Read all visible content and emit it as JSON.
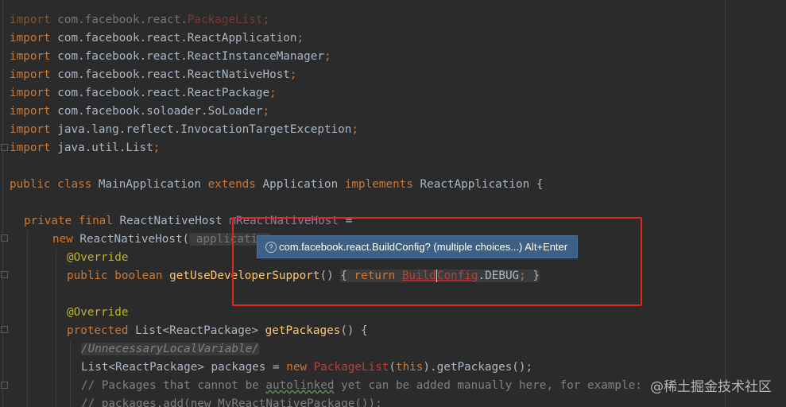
{
  "code": {
    "l1": {
      "kw": "import",
      "pkg": " com.facebook.react.",
      "cls": "PackageList",
      "end": ";"
    },
    "l2": {
      "kw": "import",
      "pkg": " com.facebook.react.ReactApplication",
      "end": ";"
    },
    "l3": {
      "kw": "import",
      "pkg": " com.facebook.react.ReactInstanceManager",
      "end": ";"
    },
    "l4": {
      "kw": "import",
      "pkg": " com.facebook.react.ReactNativeHost",
      "end": ";"
    },
    "l5": {
      "kw": "import",
      "pkg": " com.facebook.react.ReactPackage",
      "end": ";"
    },
    "l6": {
      "kw": "import",
      "pkg": " com.facebook.soloader.SoLoader",
      "end": ";"
    },
    "l7": {
      "kw": "import",
      "pkg": " java.lang.reflect.InvocationTargetException",
      "end": ";"
    },
    "l8": {
      "kw": "import",
      "pkg": " java.util.List",
      "end": ";"
    },
    "l10": {
      "public": "public",
      "class": "class",
      "name": " MainApplication ",
      "extends": "extends",
      "app": " Application ",
      "implements": "implements",
      "iface": " ReactApplication {"
    },
    "l12": {
      "mods": "private final",
      "type": " ReactNativeHost ",
      "field": "mReactNativeHost",
      "eq": " ="
    },
    "l13": {
      "new": "new",
      "ctor": " ReactNativeHost(",
      "hint": " application"
    },
    "l14": {
      "ann": "@Override"
    },
    "l15": {
      "mods": "public boolean",
      "fn": "getUseDeveloperSupport",
      "paren": "() ",
      "open": "{ ",
      "ret": "return",
      "err_a": "Build",
      "err_b": "Config",
      "tail": ".DEBUG",
      "semi": ";",
      "close": " }"
    },
    "l17": {
      "ann": "@Override"
    },
    "l18": {
      "mods": "protected",
      "type": " List<ReactPackage> ",
      "fn": "getPackages",
      "rest": "() {"
    },
    "l19": {
      "comment": "/UnnecessaryLocalVariable/"
    },
    "l20": {
      "type": "List<ReactPackage> packages = ",
      "new": "new",
      "cls": " PackageList",
      "open": "(",
      "this": "this",
      "rest": ").getPackages();"
    },
    "l21": {
      "a": "// Packages that cannot be ",
      "typo": "autolinked",
      "b": " yet can be added manually here, for example:"
    },
    "l22": {
      "text": "// packages.add(new MyReactNativePackage());"
    }
  },
  "tooltip": {
    "icon": "?",
    "text": "com.facebook.react.BuildConfig? (multiple choices...) Alt+Enter"
  },
  "watermark": "@稀土掘金技术社区"
}
